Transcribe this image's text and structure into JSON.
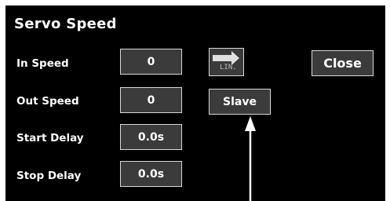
{
  "title": "Servo Speed",
  "rows": [
    {
      "label": "In Speed",
      "value": "0"
    },
    {
      "label": "Out Speed",
      "value": "0"
    },
    {
      "label": "Start Delay",
      "value": "0.0s"
    },
    {
      "label": "Stop Delay",
      "value": "0.0s"
    }
  ],
  "curve_button": {
    "icon": "right-arrow-icon",
    "label": "LIN."
  },
  "slave_button": {
    "label": "Slave"
  },
  "close_button": {
    "label": "Close"
  },
  "colors": {
    "screen_bg": "#000000",
    "button_bg": "#3b3b3b",
    "button_border": "#d8d8d8",
    "text": "#ffffff"
  }
}
